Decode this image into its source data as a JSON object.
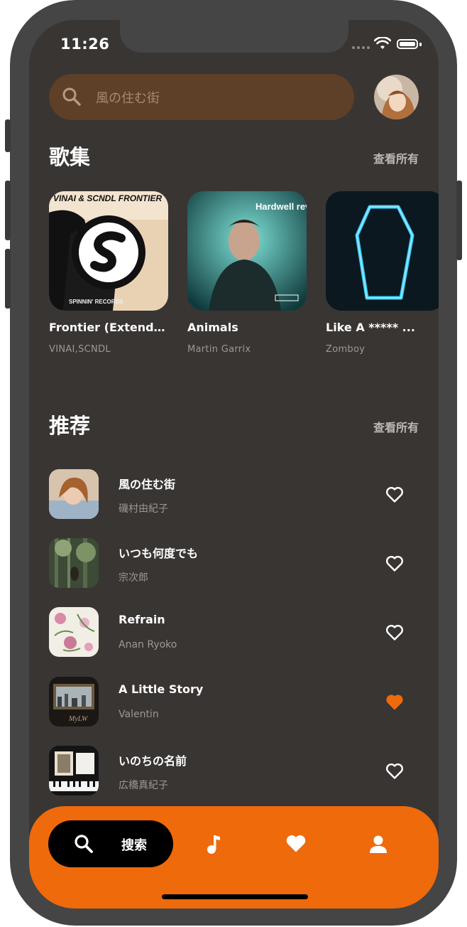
{
  "status_bar": {
    "time": "11:26"
  },
  "search": {
    "placeholder": "風の住む街"
  },
  "albums_section": {
    "title": "歌集",
    "see_all": "查看所有",
    "items": [
      {
        "name": "Frontier (Extended Mix)",
        "artist": "VINAI,SCNDL",
        "cover_text": "VINAI & SCNDL FRONTIER"
      },
      {
        "name": "Animals",
        "artist": "Martin Garrix",
        "cover_text": "Hardwell revealed"
      },
      {
        "name": "Like A ***** ...",
        "artist": "Zomboy",
        "cover_text": ""
      }
    ]
  },
  "recommend_section": {
    "title": "推荐",
    "see_all": "查看所有",
    "items": [
      {
        "title": "風の住む街",
        "artist": "磯村由紀子",
        "liked": false
      },
      {
        "title": "いつも何度でも",
        "artist": "宗次郎",
        "liked": false
      },
      {
        "title": "Refrain",
        "artist": "Anan Ryoko",
        "liked": false
      },
      {
        "title": "A Little Story",
        "artist": "Valentin",
        "liked": true
      },
      {
        "title": "いのちの名前",
        "artist": "広橋真紀子",
        "liked": false
      }
    ]
  },
  "tab_bar": {
    "active_label": "搜索",
    "tabs": [
      "search-icon",
      "music-note-icon",
      "heart-icon",
      "user-icon"
    ]
  },
  "colors": {
    "accent": "#ee6a0a",
    "background": "#393533",
    "search_bg": "#5e3f27"
  }
}
